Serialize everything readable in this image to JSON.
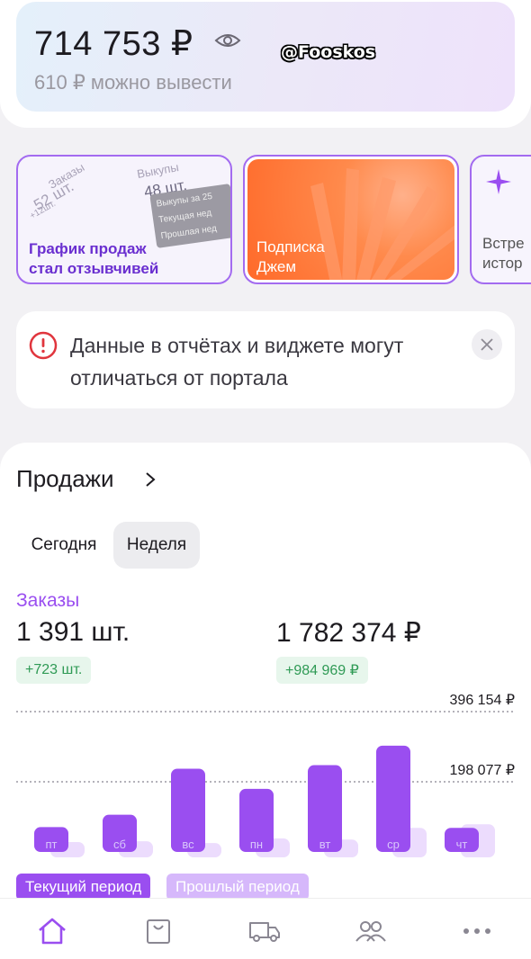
{
  "balance": {
    "amount": "714 753 ₽",
    "withdrawable": "610 ₽ можно вывести",
    "watermark": "@Fooskos"
  },
  "stories": [
    {
      "title": "График продаж\nстал отзывчивей",
      "decor": {
        "orders_label": "Заказы",
        "orders_value": "52 шт.",
        "orders_delta": "+12шт.",
        "buyouts_label": "Выкупы",
        "buyouts_value": "48 шт.",
        "card_line1": "Выкупы за 25",
        "card_line2": "Текущая нед",
        "card_line3": "Прошлая нед"
      }
    },
    {
      "title": "Подписка\nДжем"
    },
    {
      "title": "Встре\nистор"
    }
  ],
  "notice": {
    "text": "Данные в отчётах и виджете могут отличаться от портала",
    "icon": "alert-circle-icon",
    "close_icon": "close-icon"
  },
  "sales": {
    "title": "Продажи",
    "periods": [
      "Сегодня",
      "Неделя"
    ],
    "selected_period": "Неделя",
    "metric_label": "Заказы",
    "orders_count": "1 391 шт.",
    "orders_sum": "1 782 374 ₽",
    "orders_delta": "+723 шт.",
    "sum_delta": "+984 969 ₽",
    "legend_current": "Текущий период",
    "legend_previous": "Прошлый период"
  },
  "chart_data": {
    "type": "bar",
    "categories": [
      "пт",
      "сб",
      "вс",
      "пн",
      "вт",
      "ср",
      "чт"
    ],
    "series": [
      {
        "name": "Текущий период",
        "values": [
          70000,
          105000,
          235000,
          178000,
          245000,
          300000,
          68000
        ]
      },
      {
        "name": "Прошлый период",
        "values": [
          28000,
          30000,
          25000,
          38000,
          35000,
          68000,
          78000
        ]
      }
    ],
    "gridlines": [
      {
        "value": 396154,
        "label": "396 154 ₽"
      },
      {
        "value": 198077,
        "label": "198 077 ₽"
      }
    ],
    "ylim": [
      0,
      396154
    ],
    "colors": {
      "current": "#9a4ef0",
      "previous": "#ecdcfd"
    }
  },
  "nav": [
    {
      "icon": "home-icon",
      "active": true
    },
    {
      "icon": "shopping-bag-icon",
      "active": false
    },
    {
      "icon": "truck-icon",
      "active": false
    },
    {
      "icon": "people-icon",
      "active": false
    },
    {
      "icon": "more-dots-icon",
      "active": false
    }
  ],
  "colors": {
    "accent": "#9a4ef0",
    "positive": "#2f9a55",
    "alert": "#e0353d"
  }
}
